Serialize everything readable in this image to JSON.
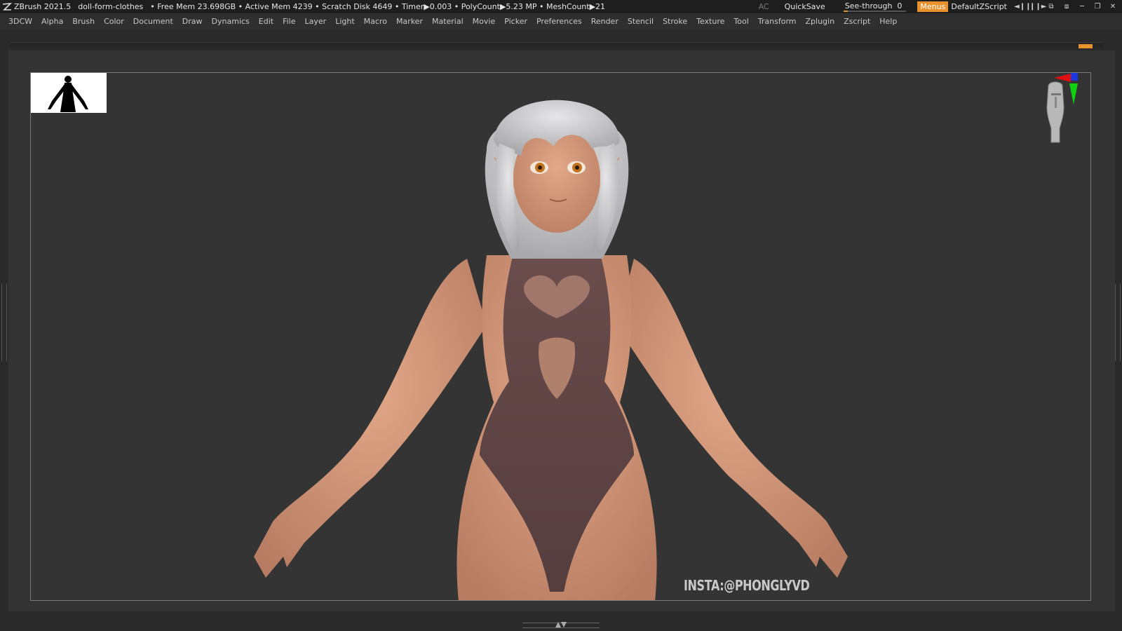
{
  "title_bar": {
    "app": "ZBrush 2021.5",
    "document": "doll-form-clothes",
    "stats": "• Free Mem 23.698GB • Active Mem 4239 • Scratch Disk 4649 • Timer▶0.003 • PolyCount▶5.23 MP • MeshCount▶21",
    "ac": "AC",
    "quicksave": "QuickSave",
    "see_through_label": "See-through",
    "see_through_value": "0",
    "see_through_fraction": 0,
    "menus": "Menus",
    "script": "DefaultZScript",
    "icons": [
      "menu-ticks-icon",
      "menu-ticks-icon",
      "copy-window-icon",
      "swap-window-icon",
      "minimize-icon",
      "restore-icon",
      "close-icon"
    ]
  },
  "menu_bar": {
    "items": [
      "3DCW",
      "Alpha",
      "Brush",
      "Color",
      "Document",
      "Draw",
      "Dynamics",
      "Edit",
      "File",
      "Layer",
      "Light",
      "Macro",
      "Marker",
      "Material",
      "Movie",
      "Picker",
      "Preferences",
      "Render",
      "Stencil",
      "Stroke",
      "Texture",
      "Tool",
      "Transform",
      "Zplugin",
      "Zscript",
      "Help"
    ]
  },
  "viewport": {
    "watermark": "INSTA:@PHONGLYVD",
    "colors": {
      "accent": "#e8912d",
      "skin": "#d69a7c",
      "suit": "#5e4545",
      "hair": "#cfcfd2",
      "background": "#343434"
    }
  }
}
